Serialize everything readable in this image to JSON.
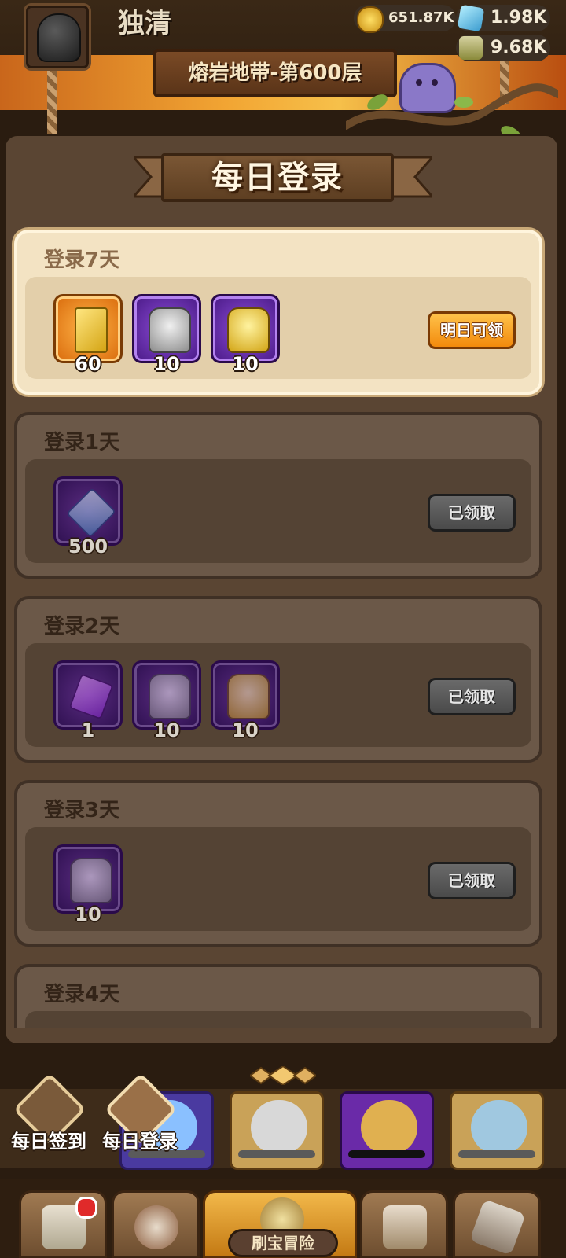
{
  "header": {
    "username": "独清",
    "resources": {
      "gold": "651.87K",
      "gems": "1.98K",
      "potion": "9.68K"
    },
    "stage": "熔岩地带-第600层"
  },
  "panel": {
    "title": "每日登录",
    "cards": [
      {
        "day": "登录7天",
        "state": "active",
        "button": "明日可领",
        "items": [
          {
            "icon": "gold-card-icon",
            "qty": "60"
          },
          {
            "icon": "silver-scroll-icon",
            "qty": "10"
          },
          {
            "icon": "gold-scroll-icon",
            "qty": "10"
          }
        ]
      },
      {
        "day": "登录1天",
        "state": "claimed",
        "button": "已领取",
        "items": [
          {
            "icon": "blue-gem-icon",
            "qty": "500"
          }
        ]
      },
      {
        "day": "登录2天",
        "state": "claimed",
        "button": "已领取",
        "items": [
          {
            "icon": "purple-cube-icon",
            "qty": "1"
          },
          {
            "icon": "silver-scroll-icon",
            "qty": "10"
          },
          {
            "icon": "gold-scroll-icon",
            "qty": "10"
          }
        ]
      },
      {
        "day": "登录3天",
        "state": "claimed",
        "button": "已领取",
        "items": [
          {
            "icon": "silver-scroll-icon",
            "qty": "10"
          }
        ]
      },
      {
        "day": "登录4天",
        "state": "claimed",
        "button": "",
        "items": []
      }
    ]
  },
  "side_buttons": {
    "daily_signin": "每日签到",
    "daily_login": "每日登录"
  },
  "nav": {
    "adventure": "刷宝冒险"
  },
  "colors": {
    "accent_orange": "#f28a0c",
    "claimed_grey": "#4a4a4a",
    "panel_brown": "#5a4533"
  }
}
